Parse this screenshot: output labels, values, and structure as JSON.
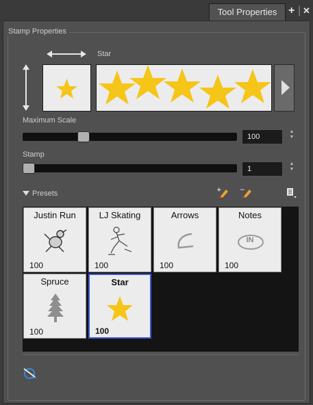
{
  "tab": {
    "label": "Tool Properties"
  },
  "group": {
    "title": "Stamp Properties"
  },
  "preview": {
    "name": "Star",
    "next_button": "▶"
  },
  "max_scale": {
    "label": "Maximum Scale",
    "value": "100",
    "level": 0.27
  },
  "stamp": {
    "label": "Stamp",
    "value": "1",
    "level": 0.0
  },
  "presets": {
    "label": "Presets",
    "items": [
      {
        "name": "Justin Run",
        "value": "100",
        "icon": "running-figure-icon"
      },
      {
        "name": "LJ Skating",
        "value": "100",
        "icon": "skater-figure-icon"
      },
      {
        "name": "Arrows",
        "value": "100",
        "icon": "arrow-brush-icon"
      },
      {
        "name": "Notes",
        "value": "100",
        "icon": "note-brush-icon"
      },
      {
        "name": "Spruce",
        "value": "100",
        "icon": "spruce-tree-icon"
      },
      {
        "name": "Star",
        "value": "100",
        "icon": "star-icon",
        "selected": true
      }
    ],
    "note_text": "IN"
  },
  "colors": {
    "star": "#f5c518",
    "selection": "#3a57d6",
    "panel": "#505050"
  }
}
